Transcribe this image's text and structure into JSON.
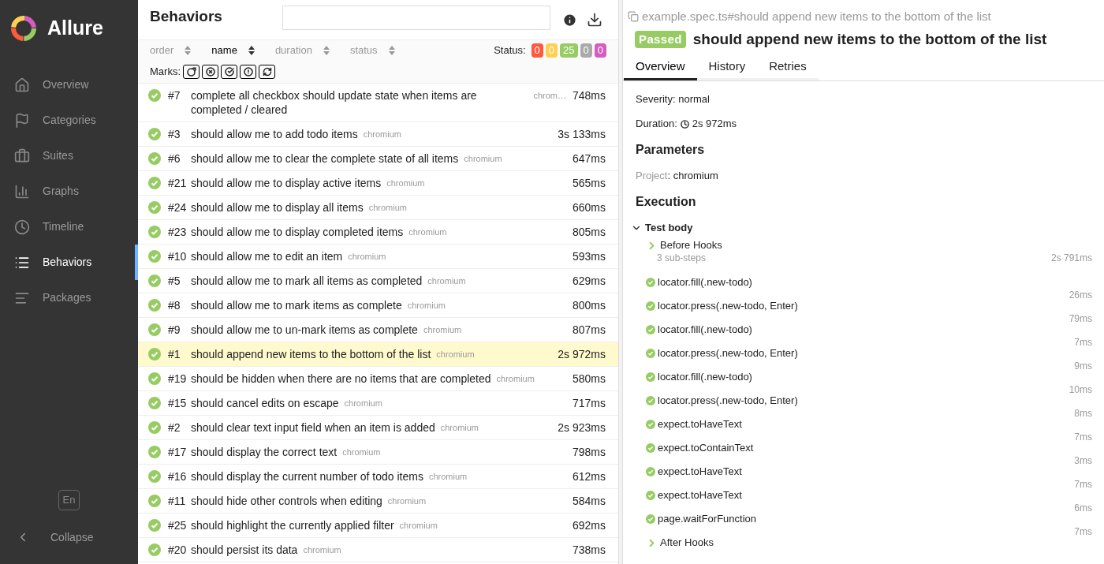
{
  "sidebar": {
    "logo": "Allure",
    "items": [
      {
        "label": "Overview",
        "selected": false
      },
      {
        "label": "Categories",
        "selected": false
      },
      {
        "label": "Suites",
        "selected": false
      },
      {
        "label": "Graphs",
        "selected": false
      },
      {
        "label": "Timeline",
        "selected": false
      },
      {
        "label": "Behaviors",
        "selected": true
      },
      {
        "label": "Packages",
        "selected": false
      }
    ],
    "language": "En",
    "collapse": "Collapse"
  },
  "list": {
    "title": "Behaviors",
    "sort": [
      {
        "label": "order",
        "selected": false
      },
      {
        "label": "name",
        "selected": true
      },
      {
        "label": "duration",
        "selected": false
      },
      {
        "label": "status",
        "selected": false
      }
    ],
    "status_label": "Status:",
    "status_counts": [
      {
        "value": "0",
        "color": "#fd5a3e"
      },
      {
        "value": "0",
        "color": "#ffd050"
      },
      {
        "value": "25",
        "color": "#97cc64"
      },
      {
        "value": "0",
        "color": "#aaaaaa"
      },
      {
        "value": "0",
        "color": "#d35ebe"
      }
    ],
    "marks_label": "Marks:",
    "rows": [
      {
        "number": "#7",
        "name": "complete all checkbox should update state when items are completed / cleared",
        "tag": "chrom…",
        "duration": "748ms",
        "selected": false
      },
      {
        "number": "#3",
        "name": "should allow me to add todo items",
        "tag": "chromium",
        "duration": "3s 133ms",
        "selected": false
      },
      {
        "number": "#6",
        "name": "should allow me to clear the complete state of all items",
        "tag": "chromium",
        "duration": "647ms",
        "selected": false
      },
      {
        "number": "#21",
        "name": "should allow me to display active items",
        "tag": "chromium",
        "duration": "565ms",
        "selected": false
      },
      {
        "number": "#24",
        "name": "should allow me to display all items",
        "tag": "chromium",
        "duration": "660ms",
        "selected": false
      },
      {
        "number": "#23",
        "name": "should allow me to display completed items",
        "tag": "chromium",
        "duration": "805ms",
        "selected": false
      },
      {
        "number": "#10",
        "name": "should allow me to edit an item",
        "tag": "chromium",
        "duration": "593ms",
        "selected": false
      },
      {
        "number": "#5",
        "name": "should allow me to mark all items as completed",
        "tag": "chromium",
        "duration": "629ms",
        "selected": false
      },
      {
        "number": "#8",
        "name": "should allow me to mark items as complete",
        "tag": "chromium",
        "duration": "800ms",
        "selected": false
      },
      {
        "number": "#9",
        "name": "should allow me to un-mark items as complete",
        "tag": "chromium",
        "duration": "807ms",
        "selected": false
      },
      {
        "number": "#1",
        "name": "should append new items to the bottom of the list",
        "tag": "chromium",
        "duration": "2s 972ms",
        "selected": true
      },
      {
        "number": "#19",
        "name": "should be hidden when there are no items that are completed",
        "tag": "chromium",
        "duration": "580ms",
        "selected": false
      },
      {
        "number": "#15",
        "name": "should cancel edits on escape",
        "tag": "chromium",
        "duration": "717ms",
        "selected": false
      },
      {
        "number": "#2",
        "name": "should clear text input field when an item is added",
        "tag": "chromium",
        "duration": "2s 923ms",
        "selected": false
      },
      {
        "number": "#17",
        "name": "should display the correct text",
        "tag": "chromium",
        "duration": "798ms",
        "selected": false
      },
      {
        "number": "#16",
        "name": "should display the current number of todo items",
        "tag": "chromium",
        "duration": "612ms",
        "selected": false
      },
      {
        "number": "#11",
        "name": "should hide other controls when editing",
        "tag": "chromium",
        "duration": "584ms",
        "selected": false
      },
      {
        "number": "#25",
        "name": "should highlight the currently applied filter",
        "tag": "chromium",
        "duration": "692ms",
        "selected": false
      },
      {
        "number": "#20",
        "name": "should persist its data",
        "tag": "chromium",
        "duration": "738ms",
        "selected": false
      }
    ]
  },
  "detail": {
    "path": "example.spec.ts#should append new items to the bottom of the list",
    "status": "Passed",
    "title": "should append new items to the bottom of the list",
    "tabs": [
      {
        "label": "Overview",
        "selected": true
      },
      {
        "label": "History",
        "selected": false
      },
      {
        "label": "Retries",
        "selected": false
      }
    ],
    "severity_label": "Severity:",
    "severity": "normal",
    "duration_label": "Duration:",
    "duration": "2s 972ms",
    "parameters_heading": "Parameters",
    "parameter": {
      "name": "Project",
      "value": ": chromium"
    },
    "execution_heading": "Execution",
    "test_body": {
      "label": "Test body",
      "expanded": true
    },
    "steps": [
      {
        "kind": "group",
        "name": "Before Hooks",
        "sub": "3 sub-steps",
        "duration": "2s 791ms"
      },
      {
        "kind": "step",
        "name": "locator.fill(.new-todo)",
        "duration": "26ms"
      },
      {
        "kind": "step",
        "name": "locator.press(.new-todo, Enter)",
        "duration": "79ms"
      },
      {
        "kind": "step",
        "name": "locator.fill(.new-todo)",
        "duration": "7ms"
      },
      {
        "kind": "step",
        "name": "locator.press(.new-todo, Enter)",
        "duration": "9ms"
      },
      {
        "kind": "step",
        "name": "locator.fill(.new-todo)",
        "duration": "10ms"
      },
      {
        "kind": "step",
        "name": "locator.press(.new-todo, Enter)",
        "duration": "8ms"
      },
      {
        "kind": "step",
        "name": "expect.toHaveText",
        "duration": "7ms"
      },
      {
        "kind": "step",
        "name": "expect.toContainText",
        "duration": "3ms"
      },
      {
        "kind": "step",
        "name": "expect.toHaveText",
        "duration": "7ms"
      },
      {
        "kind": "step",
        "name": "expect.toHaveText",
        "duration": "6ms"
      },
      {
        "kind": "step",
        "name": "page.waitForFunction",
        "duration": "7ms"
      },
      {
        "kind": "group",
        "name": "After Hooks"
      }
    ]
  }
}
